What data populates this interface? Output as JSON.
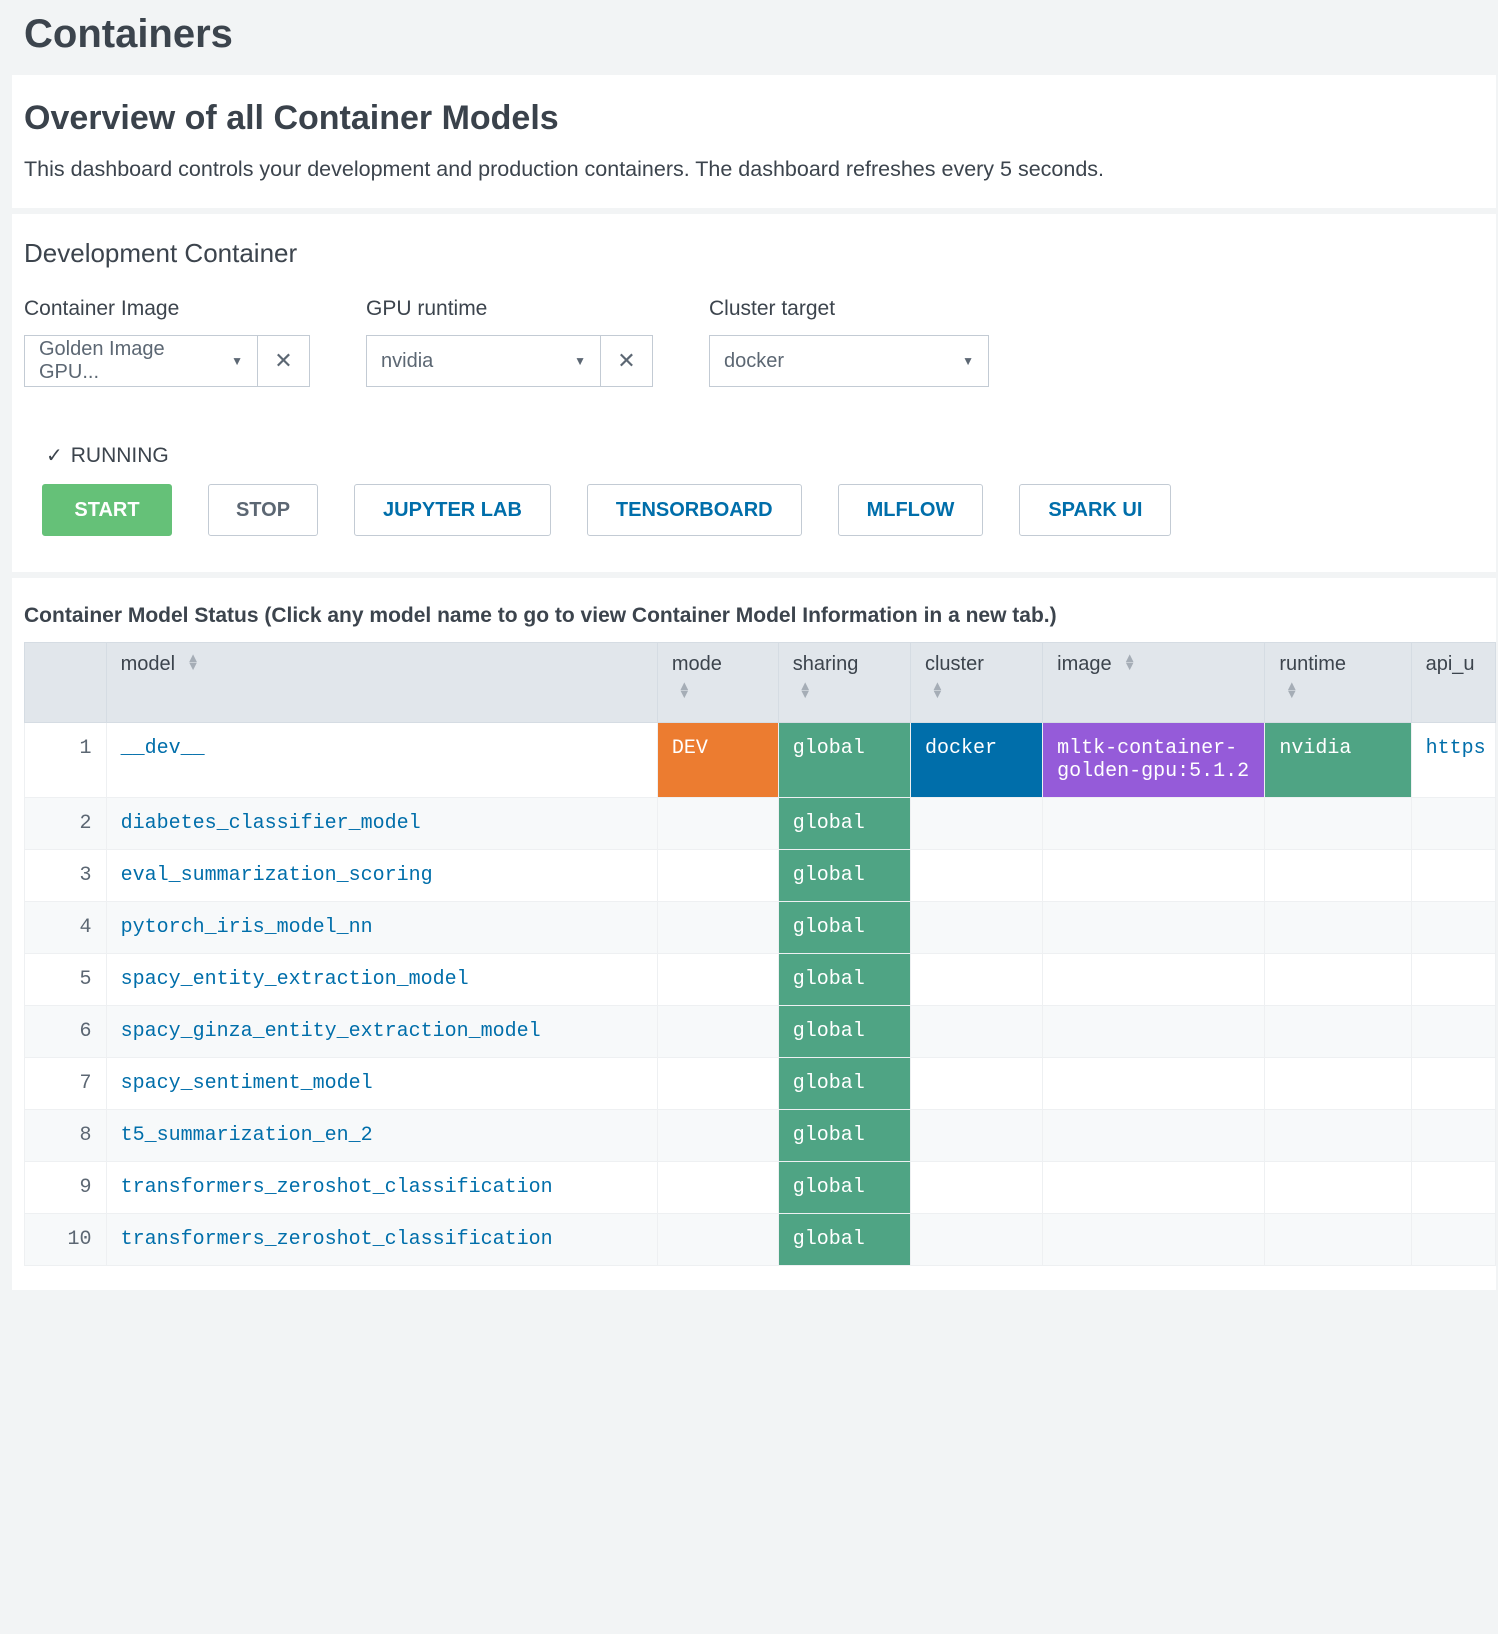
{
  "page": {
    "title": "Containers"
  },
  "overview": {
    "title": "Overview of all Container Models",
    "description": "This dashboard controls your development and production containers. The dashboard refreshes every 5 seconds."
  },
  "dev_container": {
    "section_title": "Development Container",
    "image_label": "Container Image",
    "image_value": "Golden Image GPU...",
    "gpu_label": "GPU runtime",
    "gpu_value": "nvidia",
    "cluster_label": "Cluster target",
    "cluster_value": "docker",
    "status_text": "RUNNING",
    "buttons": {
      "start": "START",
      "stop": "STOP",
      "jupyter": "JUPYTER LAB",
      "tensorboard": "TENSORBOARD",
      "mlflow": "MLFLOW",
      "spark": "SPARK UI"
    }
  },
  "table": {
    "title": "Container Model Status (Click any model name to go to view Container Model Information in a new tab.)",
    "headers": {
      "model": "model",
      "mode": "mode",
      "sharing": "sharing",
      "cluster": "cluster",
      "image": "image",
      "runtime": "runtime",
      "api_url": "api_u"
    },
    "rows": [
      {
        "n": "1",
        "model": "__dev__",
        "mode": "DEV",
        "sharing": "global",
        "cluster": "docker",
        "image": "mltk-container-golden-gpu:5.1.2",
        "runtime": "nvidia",
        "api_url": "https"
      },
      {
        "n": "2",
        "model": "diabetes_classifier_model",
        "sharing": "global"
      },
      {
        "n": "3",
        "model": "eval_summarization_scoring",
        "sharing": "global"
      },
      {
        "n": "4",
        "model": "pytorch_iris_model_nn",
        "sharing": "global"
      },
      {
        "n": "5",
        "model": "spacy_entity_extraction_model",
        "sharing": "global"
      },
      {
        "n": "6",
        "model": "spacy_ginza_entity_extraction_model",
        "sharing": "global"
      },
      {
        "n": "7",
        "model": "spacy_sentiment_model",
        "sharing": "global"
      },
      {
        "n": "8",
        "model": "t5_summarization_en_2",
        "sharing": "global"
      },
      {
        "n": "9",
        "model": "transformers_zeroshot_classification",
        "sharing": "global"
      },
      {
        "n": "10",
        "model": "transformers_zeroshot_classification",
        "sharing": "global"
      }
    ]
  }
}
